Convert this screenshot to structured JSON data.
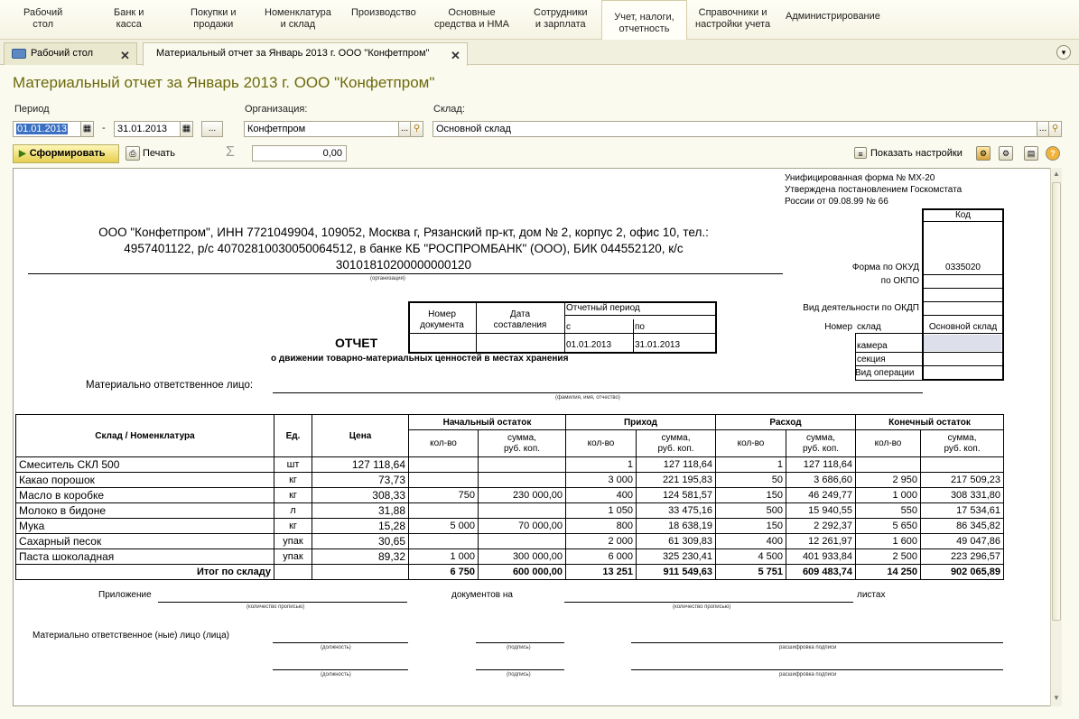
{
  "menu": [
    {
      "label": "Рабочий\nстол"
    },
    {
      "label": "Банк и\nкасса"
    },
    {
      "label": "Покупки и\nпродажи"
    },
    {
      "label": "Номенклатура\nи склад"
    },
    {
      "label": "Производство"
    },
    {
      "label": "Основные\nсредства и НМА"
    },
    {
      "label": "Сотрудники\nи зарплата"
    },
    {
      "label": "Учет, налоги,\nотчетность"
    },
    {
      "label": "Справочники и\nнастройки учета"
    },
    {
      "label": "Администрирование"
    }
  ],
  "tabs": [
    {
      "label": "Рабочий стол"
    },
    {
      "label": "Материальный отчет за Январь 2013 г. ООО \"Конфетпром\""
    }
  ],
  "title": "Материальный отчет за Январь 2013 г. ООО \"Конфетпром\"",
  "filters": {
    "period_label": "Период",
    "date_from": "01.01.2013",
    "date_to": "31.01.2013",
    "dash": "-",
    "ellipsis": "...",
    "org_label": "Организация:",
    "org_value": "Конфетпром",
    "warehouse_label": "Склад:",
    "warehouse_value": "Основной склад"
  },
  "toolbar": {
    "form_button": "Сформировать",
    "print": "Печать",
    "sum_symbol": "Σ",
    "sum_value": "0,00",
    "show_settings": "Показать настройки",
    "help": "?"
  },
  "report": {
    "form_meta": [
      "Унифицированная форма № МХ-20",
      "Утверждена постановлением Госкомстата",
      "России от 09.08.99 № 66"
    ],
    "code_header": "Код",
    "okud_label": "Форма по ОКУД",
    "okud_value": "0335020",
    "okpo_label": "по ОКПО",
    "okdp_label": "Вид деятельности по ОКДП",
    "number_label": "Номер",
    "warehouse_label": "склад",
    "warehouse_value": "Основной склад",
    "chamber_label": "камера",
    "section_label": "секция",
    "operation_label": "Вид операции",
    "org_text_lines": [
      "ООО \"Конфетпром\", ИНН 7721049904, 109052, Москва г, Рязанский пр-кт, дом № 2, корпус 2, офис 10, тел.:",
      "4957401122, р/с 40702810030050064512, в банке КБ \"РОСПРОМБАНК\" (ООО), БИК 044552120, к/с",
      "30101810200000000120"
    ],
    "org_caption": "(организация)",
    "doc_number_header": "Номер\nдокумента",
    "doc_date_header": "Дата\nсоставления",
    "period_header": "Отчетный период",
    "period_from_label": "с",
    "period_to_label": "по",
    "period_from": "01.01.2013",
    "period_to": "31.01.2013",
    "report_title": "ОТЧЕТ",
    "report_subtitle": "о движении товарно-материальных ценностей в местах хранения",
    "responsible_label": "Материально ответственное лицо:",
    "responsible_caption": "(фамилия, имя, отчество)",
    "columns": {
      "item": "Склад / Номенклатура",
      "unit": "Ед.",
      "price": "Цена",
      "opening": "Начальный остаток",
      "income": "Приход",
      "expense": "Расход",
      "closing": "Конечный остаток",
      "qty": "кол-во",
      "sum": "сумма,\nруб. коп."
    },
    "rows": [
      {
        "name": "Смеситель СКЛ 500",
        "unit": "шт",
        "price": "127 118,64",
        "oq": "",
        "os": "",
        "iq": "1",
        "is": "127 118,64",
        "eq": "1",
        "es": "127 118,64",
        "cq": "",
        "cs": ""
      },
      {
        "name": "Какао порошок",
        "unit": "кг",
        "price": "73,73",
        "oq": "",
        "os": "",
        "iq": "3 000",
        "is": "221 195,83",
        "eq": "50",
        "es": "3 686,60",
        "cq": "2 950",
        "cs": "217 509,23"
      },
      {
        "name": "Масло в коробке",
        "unit": "кг",
        "price": "308,33",
        "oq": "750",
        "os": "230 000,00",
        "iq": "400",
        "is": "124 581,57",
        "eq": "150",
        "es": "46 249,77",
        "cq": "1 000",
        "cs": "308 331,80"
      },
      {
        "name": "Молоко в бидоне",
        "unit": "л",
        "price": "31,88",
        "oq": "",
        "os": "",
        "iq": "1 050",
        "is": "33 475,16",
        "eq": "500",
        "es": "15 940,55",
        "cq": "550",
        "cs": "17 534,61"
      },
      {
        "name": "Мука",
        "unit": "кг",
        "price": "15,28",
        "oq": "5 000",
        "os": "70 000,00",
        "iq": "800",
        "is": "18 638,19",
        "eq": "150",
        "es": "2 292,37",
        "cq": "5 650",
        "cs": "86 345,82"
      },
      {
        "name": "Сахарный песок",
        "unit": "упак",
        "price": "30,65",
        "oq": "",
        "os": "",
        "iq": "2 000",
        "is": "61 309,83",
        "eq": "400",
        "es": "12 261,97",
        "cq": "1 600",
        "cs": "49 047,86"
      },
      {
        "name": "Паста шоколадная",
        "unit": "упак",
        "price": "89,32",
        "oq": "1 000",
        "os": "300 000,00",
        "iq": "6 000",
        "is": "325 230,41",
        "eq": "4 500",
        "es": "401 933,84",
        "cq": "2 500",
        "cs": "223 296,57"
      }
    ],
    "total": {
      "label": "Итог по складу",
      "oq": "6 750",
      "os": "600 000,00",
      "iq": "13 251",
      "is": "911 549,63",
      "eq": "5 751",
      "es": "609 483,74",
      "cq": "14 250",
      "cs": "902 065,89"
    },
    "attachment_label": "Приложение",
    "docs_on_label": "документов на",
    "sheets_label": "листах",
    "qty_words_caption": "(количество прописью)",
    "signers_label": "Материально ответственное (ные) лицо (лица)",
    "position_caption": "(должность)",
    "signature_caption": "(подпись)",
    "decoding_caption": "расшифровка подписи"
  }
}
